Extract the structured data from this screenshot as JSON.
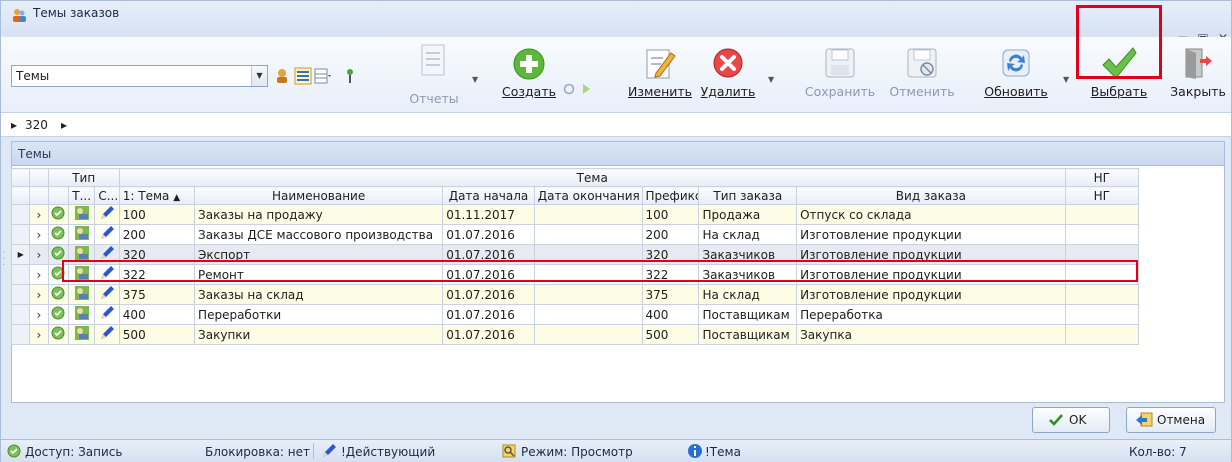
{
  "window": {
    "title": "Темы заказов"
  },
  "toolbar": {
    "combo_value": "Темы",
    "reports": "Отчеты",
    "create": "Создать",
    "edit": "Изменить",
    "delete": "Удалить",
    "save": "Сохранить",
    "cancel": "Отменить",
    "refresh": "Обновить",
    "select": "Выбрать",
    "close": "Закрыть"
  },
  "breadcrumb": {
    "value": "320"
  },
  "panel": {
    "title": "Темы"
  },
  "grid": {
    "band_type": "Тип",
    "band_theme": "Тема",
    "band_ng": "НГ",
    "col_t": "Т...",
    "col_c": "С...",
    "col_theme": "1: Тема",
    "col_name": "Наименование",
    "col_start": "Дата начала",
    "col_end": "Дата окончания",
    "col_prefix": "Префикс",
    "col_order_type": "Тип заказа",
    "col_order_kind": "Вид заказа",
    "col_ng": "НГ",
    "rows": [
      {
        "theme": "100",
        "name": "Заказы на продажу",
        "start": "01.11.2017",
        "end": "",
        "prefix": "100",
        "order_type": "Продажа",
        "order_kind": "Отпуск со склада"
      },
      {
        "theme": "200",
        "name": "Заказы ДСЕ массового производства",
        "start": "01.07.2016",
        "end": "",
        "prefix": "200",
        "order_type": "На склад",
        "order_kind": "Изготовление продукции"
      },
      {
        "theme": "320",
        "name": "Экспорт",
        "start": "01.07.2016",
        "end": "",
        "prefix": "320",
        "order_type": "Заказчиков",
        "order_kind": "Изготовление продукции"
      },
      {
        "theme": "322",
        "name": "Ремонт",
        "start": "01.07.2016",
        "end": "",
        "prefix": "322",
        "order_type": "Заказчиков",
        "order_kind": "Изготовление продукции"
      },
      {
        "theme": "375",
        "name": "Заказы на склад",
        "start": "01.07.2016",
        "end": "",
        "prefix": "375",
        "order_type": "На склад",
        "order_kind": "Изготовление продукции"
      },
      {
        "theme": "400",
        "name": "Переработки",
        "start": "01.07.2016",
        "end": "",
        "prefix": "400",
        "order_type": "Поставщикам",
        "order_kind": "Переработка"
      },
      {
        "theme": "500",
        "name": "Закупки",
        "start": "01.07.2016",
        "end": "",
        "prefix": "500",
        "order_type": "Поставщикам",
        "order_kind": "Закупка"
      }
    ]
  },
  "buttons": {
    "ok": "OK",
    "cancel": "Отмена"
  },
  "status": {
    "access": "Доступ: Запись",
    "lock": "Блокировка: нет",
    "state": "!Действующий",
    "mode": "Режим: Просмотр",
    "theme": "!Тема",
    "count": "Кол-во: 7"
  },
  "colors": {
    "highlight": "#e0001a",
    "accent": "#2f8f1e",
    "alt_row": "#fdfce4"
  }
}
